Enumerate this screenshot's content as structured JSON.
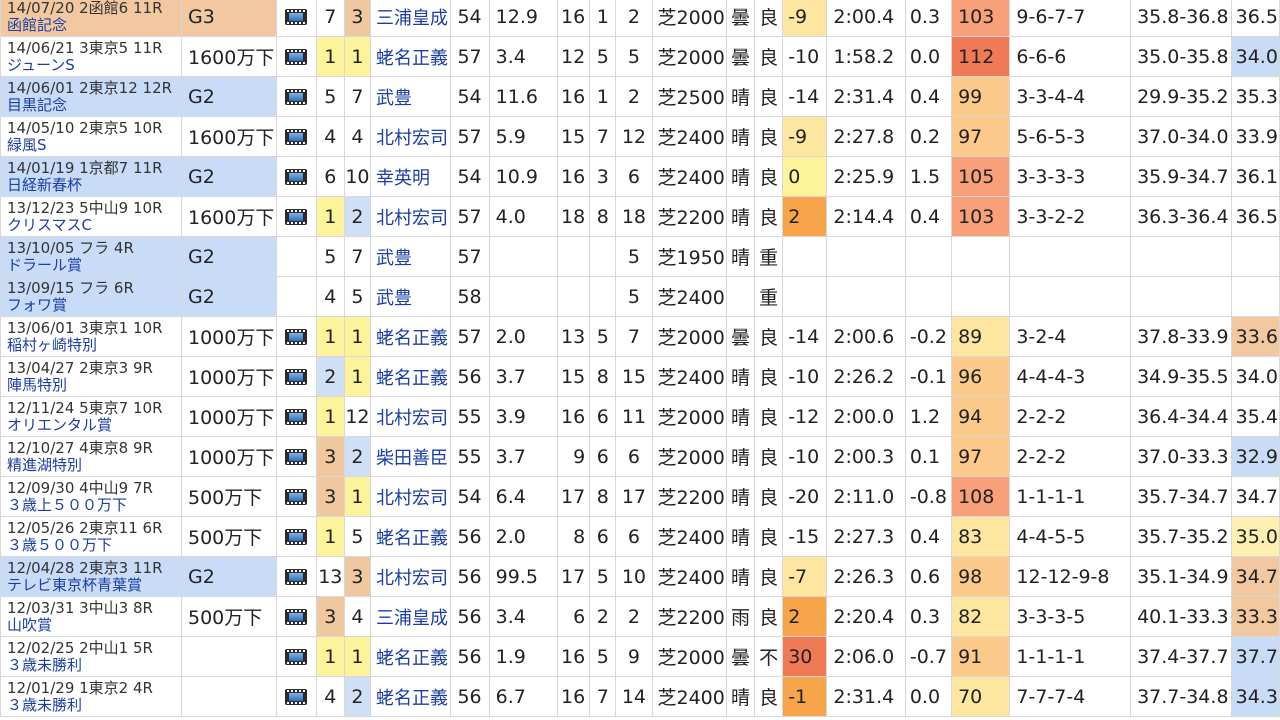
{
  "colors": {
    "grade_g3": "#f2c8a0",
    "grade_g2": "#c9dcf7",
    "rank_1": "#fdf39a",
    "rank_2": "#cfe0f6",
    "rank_3": "#f0c8a0",
    "bias_red": "#f07a55",
    "bias_orange": "#f8a44a",
    "bias_yellow": "#fde6a0",
    "idx_high": "#f7a07a",
    "idx_mid": "#fbc98a",
    "idx_low": "#fde6a0",
    "last_blue": "#c9dcf7",
    "last_orange": "#f2c8a0",
    "last_yellow": "#fdf0b0"
  },
  "icons": {
    "video": "film-video-icon"
  },
  "rows": [
    {
      "race_info": "14/07/20 2函館6 11R",
      "race_name": "函館記念",
      "grade": "G3",
      "video": true,
      "pop": "7",
      "rank": "3",
      "jockey": "三浦皇成",
      "weight": "54",
      "odds": "12.9",
      "heads": "16",
      "gate": "1",
      "num": "2",
      "dist": "芝2000",
      "weather": "曇",
      "cond": "良",
      "bias": "-9",
      "time": "2:00.4",
      "diff": "0.3",
      "idx": "103",
      "pass": "9-6-7-7",
      "pace": "35.8-36.8",
      "last": "36.5",
      "grade_bg": "#f2c8a0",
      "race_bg": "#f2c8a0",
      "rank_bg": "#f0c8a0",
      "bias_bg": "#fde6a0",
      "idx_bg": "#f7a07a",
      "last_bg": ""
    },
    {
      "race_info": "14/06/21 3東京5 11R",
      "race_name": "ジューンS",
      "grade": "1600万下",
      "video": true,
      "pop": "1",
      "rank": "1",
      "jockey": "蛯名正義",
      "weight": "57",
      "odds": "3.4",
      "heads": "12",
      "gate": "5",
      "num": "5",
      "dist": "芝2000",
      "weather": "曇",
      "cond": "良",
      "bias": "-10",
      "time": "1:58.2",
      "diff": "0.0",
      "idx": "112",
      "pass": "6-6-6",
      "pace": "35.0-35.8",
      "last": "34.0",
      "grade_bg": "",
      "race_bg": "",
      "rank_bg": "#fdf39a",
      "pop_bg": "#fdf39a",
      "bias_bg": "",
      "idx_bg": "#f07a55",
      "last_bg": "#c9dcf7"
    },
    {
      "race_info": "14/06/01 2東京12 12R",
      "race_name": "目黒記念",
      "grade": "G2",
      "video": true,
      "pop": "5",
      "rank": "7",
      "jockey": "武豊",
      "weight": "54",
      "odds": "11.6",
      "heads": "16",
      "gate": "1",
      "num": "2",
      "dist": "芝2500",
      "weather": "晴",
      "cond": "良",
      "bias": "-14",
      "time": "2:31.4",
      "diff": "0.4",
      "idx": "99",
      "pass": "3-3-4-4",
      "pace": "29.9-35.2",
      "last": "35.3",
      "grade_bg": "#c9dcf7",
      "race_bg": "#c9dcf7",
      "rank_bg": "",
      "bias_bg": "",
      "idx_bg": "#fbc98a",
      "last_bg": ""
    },
    {
      "race_info": "14/05/10 2東京5 10R",
      "race_name": "緑風S",
      "grade": "1600万下",
      "video": true,
      "pop": "4",
      "rank": "4",
      "jockey": "北村宏司",
      "weight": "57",
      "odds": "5.9",
      "heads": "15",
      "gate": "7",
      "num": "12",
      "dist": "芝2400",
      "weather": "晴",
      "cond": "良",
      "bias": "-9",
      "time": "2:27.8",
      "diff": "0.2",
      "idx": "97",
      "pass": "5-6-5-3",
      "pace": "37.0-34.0",
      "last": "33.9",
      "grade_bg": "",
      "race_bg": "",
      "rank_bg": "",
      "bias_bg": "#fde6a0",
      "idx_bg": "#fbc98a",
      "last_bg": ""
    },
    {
      "race_info": "14/01/19 1京都7 11R",
      "race_name": "日経新春杯",
      "grade": "G2",
      "video": true,
      "pop": "6",
      "rank": "10",
      "jockey": "幸英明",
      "weight": "54",
      "odds": "10.9",
      "heads": "16",
      "gate": "3",
      "num": "6",
      "dist": "芝2400",
      "weather": "晴",
      "cond": "良",
      "bias": "0",
      "time": "2:25.9",
      "diff": "1.5",
      "idx": "105",
      "pass": "3-3-3-3",
      "pace": "35.9-34.7",
      "last": "36.1",
      "grade_bg": "#c9dcf7",
      "race_bg": "#c9dcf7",
      "rank_bg": "",
      "bias_bg": "#fdf39a",
      "idx_bg": "#f7a07a",
      "last_bg": ""
    },
    {
      "race_info": "13/12/23 5中山9 10R",
      "race_name": "クリスマスC",
      "grade": "1600万下",
      "video": true,
      "pop": "1",
      "rank": "2",
      "jockey": "北村宏司",
      "weight": "57",
      "odds": "4.0",
      "heads": "18",
      "gate": "8",
      "num": "18",
      "dist": "芝2200",
      "weather": "晴",
      "cond": "良",
      "bias": "2",
      "time": "2:14.4",
      "diff": "0.4",
      "idx": "103",
      "pass": "3-3-2-2",
      "pace": "36.3-36.4",
      "last": "36.5",
      "grade_bg": "",
      "race_bg": "",
      "rank_bg": "#cfe0f6",
      "pop_bg": "#fdf39a",
      "bias_bg": "#f8a44a",
      "idx_bg": "#f7a07a",
      "last_bg": ""
    },
    {
      "race_info": "13/10/05 フラ 4R",
      "race_name": "ドラール賞",
      "grade": "G2",
      "video": false,
      "pop": "5",
      "rank": "7",
      "jockey": "武豊",
      "weight": "57",
      "odds": "",
      "heads": "",
      "gate": "",
      "num": "5",
      "dist": "芝1950",
      "weather": "晴",
      "cond": "重",
      "bias": "",
      "time": "",
      "diff": "",
      "idx": "",
      "pass": "",
      "pace": "",
      "last": "",
      "grade_bg": "#c9dcf7",
      "race_bg": "#c9dcf7",
      "rank_bg": "",
      "bias_bg": "",
      "idx_bg": "",
      "last_bg": ""
    },
    {
      "race_info": "13/09/15 フラ 6R",
      "race_name": "フォワ賞",
      "grade": "G2",
      "video": false,
      "pop": "4",
      "rank": "5",
      "jockey": "武豊",
      "weight": "58",
      "odds": "",
      "heads": "",
      "gate": "",
      "num": "5",
      "dist": "芝2400",
      "weather": "",
      "cond": "重",
      "bias": "",
      "time": "",
      "diff": "",
      "idx": "",
      "pass": "",
      "pace": "",
      "last": "",
      "grade_bg": "#c9dcf7",
      "race_bg": "#c9dcf7",
      "rank_bg": "",
      "bias_bg": "",
      "idx_bg": "",
      "last_bg": ""
    },
    {
      "race_info": "13/06/01 3東京1 10R",
      "race_name": "稲村ヶ崎特別",
      "grade": "1000万下",
      "video": true,
      "pop": "1",
      "rank": "1",
      "jockey": "蛯名正義",
      "weight": "57",
      "odds": "2.0",
      "heads": "13",
      "gate": "5",
      "num": "7",
      "dist": "芝2000",
      "weather": "曇",
      "cond": "良",
      "bias": "-14",
      "time": "2:00.6",
      "diff": "-0.2",
      "idx": "89",
      "pass": "3-2-4",
      "pace": "37.8-33.9",
      "last": "33.6",
      "grade_bg": "",
      "race_bg": "",
      "rank_bg": "#fdf39a",
      "pop_bg": "#fdf39a",
      "bias_bg": "",
      "idx_bg": "#fde6a0",
      "last_bg": "#f2c8a0"
    },
    {
      "race_info": "13/04/27 2東京3 9R",
      "race_name": "陣馬特別",
      "grade": "1000万下",
      "video": true,
      "pop": "2",
      "rank": "1",
      "jockey": "蛯名正義",
      "weight": "56",
      "odds": "3.7",
      "heads": "15",
      "gate": "8",
      "num": "15",
      "dist": "芝2400",
      "weather": "晴",
      "cond": "良",
      "bias": "-10",
      "time": "2:26.2",
      "diff": "-0.1",
      "idx": "96",
      "pass": "4-4-4-3",
      "pace": "34.9-35.5",
      "last": "34.0",
      "grade_bg": "",
      "race_bg": "",
      "rank_bg": "#fdf39a",
      "pop_bg": "#cfe0f6",
      "bias_bg": "",
      "idx_bg": "#fbc98a",
      "last_bg": ""
    },
    {
      "race_info": "12/11/24 5東京7 10R",
      "race_name": "オリエンタル賞",
      "grade": "1000万下",
      "video": true,
      "pop": "1",
      "rank": "12",
      "jockey": "北村宏司",
      "weight": "55",
      "odds": "3.9",
      "heads": "16",
      "gate": "6",
      "num": "11",
      "dist": "芝2000",
      "weather": "晴",
      "cond": "良",
      "bias": "-12",
      "time": "2:00.0",
      "diff": "1.2",
      "idx": "94",
      "pass": "2-2-2",
      "pace": "36.4-34.4",
      "last": "35.4",
      "grade_bg": "",
      "race_bg": "",
      "rank_bg": "",
      "pop_bg": "#fdf39a",
      "bias_bg": "",
      "idx_bg": "#fbc98a",
      "last_bg": ""
    },
    {
      "race_info": "12/10/27 4東京8 9R",
      "race_name": "精進湖特別",
      "grade": "1000万下",
      "video": true,
      "pop": "3",
      "rank": "2",
      "jockey": "柴田善臣",
      "weight": "55",
      "odds": "3.7",
      "heads": "9",
      "gate": "6",
      "num": "6",
      "dist": "芝2000",
      "weather": "晴",
      "cond": "良",
      "bias": "-10",
      "time": "2:00.3",
      "diff": "0.1",
      "idx": "97",
      "pass": "2-2-2",
      "pace": "37.0-33.3",
      "last": "32.9",
      "grade_bg": "",
      "race_bg": "",
      "rank_bg": "#cfe0f6",
      "pop_bg": "#f0c8a0",
      "bias_bg": "",
      "idx_bg": "#fbc98a",
      "last_bg": "#c9dcf7"
    },
    {
      "race_info": "12/09/30 4中山9 7R",
      "race_name": "３歳上５００万下",
      "grade": "500万下",
      "video": true,
      "pop": "3",
      "rank": "1",
      "jockey": "北村宏司",
      "weight": "54",
      "odds": "6.4",
      "heads": "17",
      "gate": "8",
      "num": "17",
      "dist": "芝2200",
      "weather": "晴",
      "cond": "良",
      "bias": "-20",
      "time": "2:11.0",
      "diff": "-0.8",
      "idx": "108",
      "pass": "1-1-1-1",
      "pace": "35.7-34.7",
      "last": "34.7",
      "grade_bg": "",
      "race_bg": "",
      "rank_bg": "#fdf39a",
      "pop_bg": "#f0c8a0",
      "bias_bg": "",
      "idx_bg": "#f7a07a",
      "last_bg": ""
    },
    {
      "race_info": "12/05/26 2東京11 6R",
      "race_name": "３歳５００万下",
      "grade": "500万下",
      "video": true,
      "pop": "1",
      "rank": "5",
      "jockey": "蛯名正義",
      "weight": "56",
      "odds": "2.0",
      "heads": "8",
      "gate": "6",
      "num": "6",
      "dist": "芝2400",
      "weather": "晴",
      "cond": "良",
      "bias": "-15",
      "time": "2:27.3",
      "diff": "0.4",
      "idx": "83",
      "pass": "4-4-5-5",
      "pace": "35.7-35.2",
      "last": "35.0",
      "grade_bg": "",
      "race_bg": "",
      "rank_bg": "",
      "pop_bg": "#fdf39a",
      "bias_bg": "",
      "idx_bg": "#fde6a0",
      "last_bg": "#fdf0b0"
    },
    {
      "race_info": "12/04/28 2東京3 11R",
      "race_name": "テレビ東京杯青葉賞",
      "grade": "G2",
      "video": true,
      "pop": "13",
      "rank": "3",
      "jockey": "北村宏司",
      "weight": "56",
      "odds": "99.5",
      "heads": "17",
      "gate": "5",
      "num": "10",
      "dist": "芝2400",
      "weather": "晴",
      "cond": "良",
      "bias": "-7",
      "time": "2:26.3",
      "diff": "0.6",
      "idx": "98",
      "pass": "12-12-9-8",
      "pace": "35.1-34.9",
      "last": "34.7",
      "grade_bg": "#c9dcf7",
      "race_bg": "#c9dcf7",
      "rank_bg": "#f0c8a0",
      "bias_bg": "#fde6a0",
      "idx_bg": "#fbc98a",
      "last_bg": "#f2c8a0"
    },
    {
      "race_info": "12/03/31 3中山3 8R",
      "race_name": "山吹賞",
      "grade": "500万下",
      "video": true,
      "pop": "3",
      "rank": "4",
      "jockey": "三浦皇成",
      "weight": "56",
      "odds": "3.4",
      "heads": "6",
      "gate": "2",
      "num": "2",
      "dist": "芝2200",
      "weather": "雨",
      "cond": "良",
      "bias": "2",
      "time": "2:20.4",
      "diff": "0.3",
      "idx": "82",
      "pass": "3-3-3-5",
      "pace": "40.1-33.3",
      "last": "33.3",
      "grade_bg": "",
      "race_bg": "",
      "rank_bg": "",
      "pop_bg": "#f0c8a0",
      "bias_bg": "#f8a44a",
      "idx_bg": "#fde6a0",
      "last_bg": "#f2c8a0"
    },
    {
      "race_info": "12/02/25 2中山1 5R",
      "race_name": "３歳未勝利",
      "grade": "",
      "video": true,
      "pop": "1",
      "rank": "1",
      "jockey": "蛯名正義",
      "weight": "56",
      "odds": "1.9",
      "heads": "16",
      "gate": "5",
      "num": "9",
      "dist": "芝2000",
      "weather": "曇",
      "cond": "不",
      "bias": "30",
      "time": "2:06.0",
      "diff": "-0.7",
      "idx": "91",
      "pass": "1-1-1-1",
      "pace": "37.4-37.7",
      "last": "37.7",
      "grade_bg": "",
      "race_bg": "",
      "rank_bg": "#fdf39a",
      "pop_bg": "#fdf39a",
      "bias_bg": "#f07a55",
      "idx_bg": "#fbc98a",
      "last_bg": "#c9dcf7"
    },
    {
      "race_info": "12/01/29 1東京2 4R",
      "race_name": "３歳未勝利",
      "grade": "",
      "video": true,
      "pop": "4",
      "rank": "2",
      "jockey": "蛯名正義",
      "weight": "56",
      "odds": "6.7",
      "heads": "16",
      "gate": "7",
      "num": "14",
      "dist": "芝2400",
      "weather": "晴",
      "cond": "良",
      "bias": "-1",
      "time": "2:31.4",
      "diff": "0.0",
      "idx": "70",
      "pass": "7-7-7-4",
      "pace": "37.7-34.8",
      "last": "34.3",
      "grade_bg": "",
      "race_bg": "",
      "rank_bg": "#cfe0f6",
      "bias_bg": "#f8a44a",
      "idx_bg": "#fde6a0",
      "last_bg": "#c9dcf7"
    }
  ]
}
